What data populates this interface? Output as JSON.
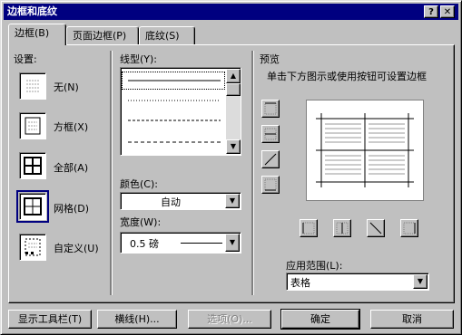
{
  "window": {
    "title": "边框和底纹",
    "help_glyph": "?",
    "close_glyph": "✕"
  },
  "tabs": [
    {
      "label": "边框(B)"
    },
    {
      "label": "页面边框(P)"
    },
    {
      "label": "底纹(S)"
    }
  ],
  "settings": {
    "header": "设置:",
    "options": [
      {
        "label": "无(N)"
      },
      {
        "label": "方框(X)"
      },
      {
        "label": "全部(A)"
      },
      {
        "label": "网格(D)",
        "selected": true
      },
      {
        "label": "自定义(U)"
      }
    ]
  },
  "line_style": {
    "header": "线型(Y):",
    "styles": [
      "solid",
      "dotted",
      "dashed",
      "dash-dot"
    ]
  },
  "color": {
    "header": "颜色(C):",
    "value": "自动"
  },
  "width": {
    "header": "宽度(W):",
    "value": "0.5 磅"
  },
  "preview": {
    "header": "预览",
    "hint": "单击下方图示或使用按钮可设置边框"
  },
  "apply_to": {
    "header": "应用范围(L):",
    "value": "表格"
  },
  "buttons": {
    "show_toolbar": "显示工具栏(T)",
    "horizontal_line": "横线(H)...",
    "options": "选项(O)...",
    "ok": "确定",
    "cancel": "取消"
  },
  "colors": {
    "titlebar": "#000080",
    "face": "#c0c0c0"
  }
}
